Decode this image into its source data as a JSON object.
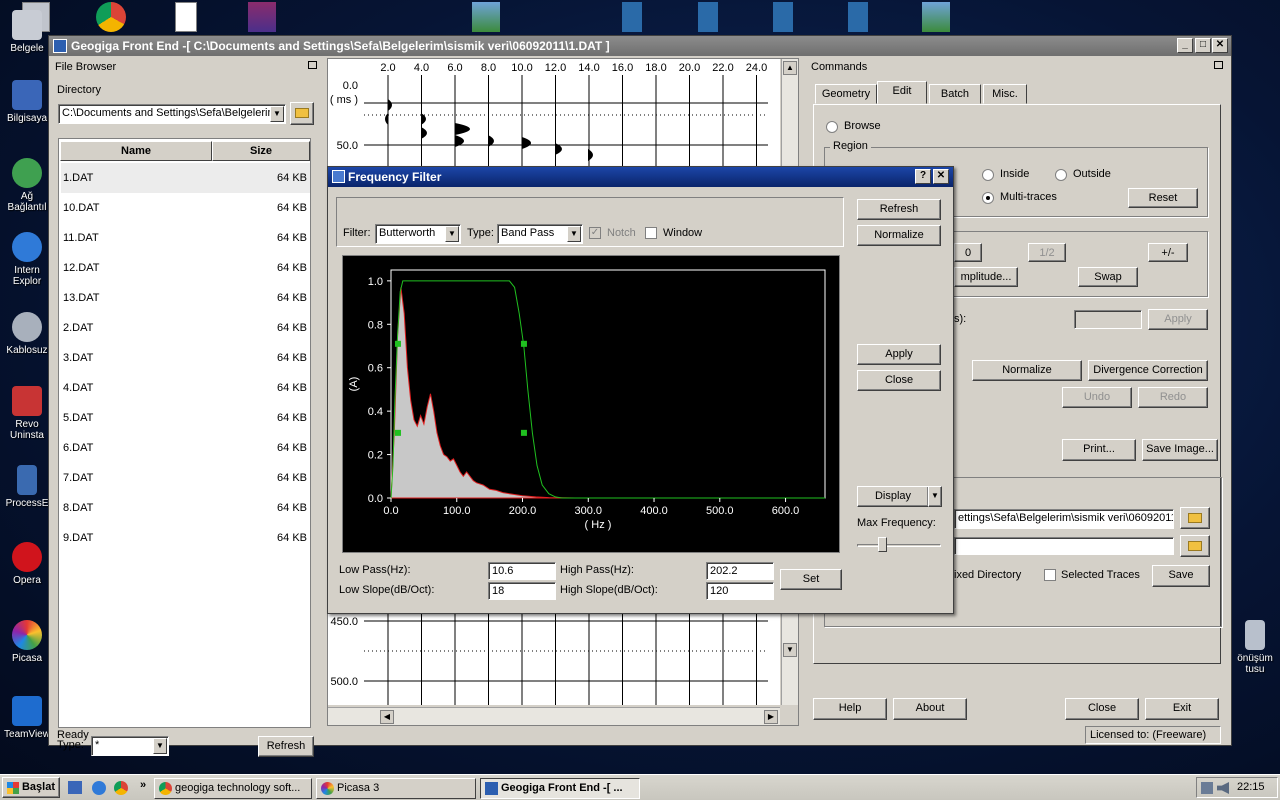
{
  "desktop": {
    "icons": [
      "Belgele",
      "Bilgisaya",
      "Ağ Bağlantıl",
      "Intern Explor",
      "Kablosuz",
      "Revo Uninsta",
      "ProcessE",
      "Opera",
      "Picasa",
      "TeamView"
    ],
    "right_icon": "önüşüm tusu"
  },
  "window": {
    "title": "Geogiga Front End -[ C:\\Documents and Settings\\Sefa\\Belgelerim\\sismik veri\\06092011\\1.DAT  ]",
    "status": "Ready",
    "license": "Licensed to: (Freeware)"
  },
  "file_browser": {
    "title": "File Browser",
    "directory_label": "Directory",
    "directory_value": "C:\\Documents and Settings\\Sefa\\Belgelerim",
    "col_name": "Name",
    "col_size": "Size",
    "files": [
      {
        "name": "1.DAT",
        "size": "64 KB"
      },
      {
        "name": "10.DAT",
        "size": "64 KB"
      },
      {
        "name": "11.DAT",
        "size": "64 KB"
      },
      {
        "name": "12.DAT",
        "size": "64 KB"
      },
      {
        "name": "13.DAT",
        "size": "64 KB"
      },
      {
        "name": "2.DAT",
        "size": "64 KB"
      },
      {
        "name": "3.DAT",
        "size": "64 KB"
      },
      {
        "name": "4.DAT",
        "size": "64 KB"
      },
      {
        "name": "5.DAT",
        "size": "64 KB"
      },
      {
        "name": "6.DAT",
        "size": "64 KB"
      },
      {
        "name": "7.DAT",
        "size": "64 KB"
      },
      {
        "name": "8.DAT",
        "size": "64 KB"
      },
      {
        "name": "9.DAT",
        "size": "64 KB"
      }
    ],
    "type_label": "Type:",
    "type_value": "*",
    "refresh": "Refresh"
  },
  "seismic": {
    "x_ticks": [
      "2.0",
      "4.0",
      "6.0",
      "8.0",
      "10.0",
      "12.0",
      "14.0",
      "16.0",
      "18.0",
      "20.0",
      "22.0",
      "24.0"
    ],
    "y_top": [
      "0.0",
      "( ms )",
      "50.0"
    ],
    "y_bottom": [
      "450.0",
      "500.0"
    ]
  },
  "commands": {
    "title": "Commands",
    "tabs": [
      "Geometry",
      "Edit",
      "Batch",
      "Misc."
    ],
    "browse": "Browse",
    "region": "Region",
    "inside": "Inside",
    "outside": "Outside",
    "multi_traces": "Multi-traces",
    "reset": "Reset",
    "zero": "0",
    "half": "1/2",
    "plus_minus": "+/-",
    "amplitude": "mplitude...",
    "swap": "Swap",
    "s_label": "s):",
    "apply": "Apply",
    "normalize": "Normalize",
    "divergence": "Divergence Correction",
    "undo": "Undo",
    "redo": "Redo",
    "print": "Print...",
    "save_image": "Save Image...",
    "path1": "ettings\\Sefa\\Belgelerim\\sismik veri\\06092011",
    "fixed_dir": "ixed Directory",
    "selected_traces": "Selected Traces",
    "save": "Save",
    "help": "Help",
    "about": "About",
    "close": "Close",
    "exit": "Exit"
  },
  "dialog": {
    "title": "Frequency Filter",
    "filter_label": "Filter:",
    "filter_value": "Butterworth",
    "type_label": "Type:",
    "type_value": "Band Pass",
    "notch": "Notch",
    "window": "Window",
    "refresh": "Refresh",
    "normalize": "Normalize",
    "apply": "Apply",
    "close": "Close",
    "display": "Display",
    "max_freq": "Max Frequency:",
    "max_freq_slider": 0.28,
    "low_pass_label": "Low Pass(Hz):",
    "low_pass_value": "10.6",
    "high_pass_label": "High Pass(Hz):",
    "high_pass_value": "202.2",
    "low_slope_label": "Low Slope(dB/Oct):",
    "low_slope_value": "18",
    "high_slope_label": "High Slope(dB/Oct):",
    "high_slope_value": "120",
    "set": "Set"
  },
  "chart_data": {
    "type": "area",
    "xlabel": "( Hz )",
    "ylabel": "(A)",
    "xlim": [
      0,
      660
    ],
    "ylim": [
      0,
      1.05
    ],
    "x_ticks": [
      0,
      100,
      200,
      300,
      400,
      500,
      600
    ],
    "x_tick_labels": [
      "0.0",
      "100.0",
      "200.0",
      "300.0",
      "400.0",
      "500.0",
      "600.0"
    ],
    "y_ticks": [
      0,
      0.2,
      0.4,
      0.6,
      0.8,
      1.0
    ],
    "y_tick_labels": [
      "0.0",
      "0.2",
      "0.4",
      "0.6",
      "0.8",
      "1.0"
    ],
    "spectrum": {
      "x": [
        0,
        5,
        10,
        15,
        20,
        25,
        30,
        35,
        40,
        45,
        50,
        55,
        60,
        65,
        70,
        75,
        80,
        85,
        90,
        95,
        100,
        105,
        110,
        115,
        120,
        125,
        130,
        140,
        150,
        160,
        170,
        180,
        190,
        200,
        220,
        240,
        260,
        280
      ],
      "y": [
        0,
        0.3,
        0.75,
        0.97,
        0.85,
        0.6,
        0.45,
        0.36,
        0.33,
        0.38,
        0.34,
        0.42,
        0.48,
        0.4,
        0.3,
        0.24,
        0.2,
        0.19,
        0.17,
        0.18,
        0.15,
        0.12,
        0.1,
        0.12,
        0.1,
        0.08,
        0.07,
        0.06,
        0.04,
        0.035,
        0.025,
        0.02,
        0.015,
        0.01,
        0.005,
        0.002,
        0.001,
        0
      ]
    },
    "filter_curve": {
      "x": [
        0,
        3,
        6,
        10,
        14,
        18,
        22,
        180,
        188,
        195,
        202,
        208,
        215,
        222,
        230,
        240,
        250,
        260,
        660
      ],
      "y": [
        0,
        0.15,
        0.45,
        0.75,
        0.95,
        1.0,
        1.0,
        1.0,
        0.97,
        0.85,
        0.7,
        0.5,
        0.3,
        0.15,
        0.06,
        0.02,
        0.005,
        0,
        0
      ]
    },
    "handles": {
      "x": [
        10.6,
        10.6,
        202.2,
        202.2
      ],
      "y": [
        0.71,
        0.3,
        0.71,
        0.3
      ]
    }
  },
  "taskbar": {
    "start": "Başlat",
    "tasks": [
      "geogiga technology soft...",
      "Picasa 3",
      "Geogiga Front End -[ ..."
    ],
    "clock": "22:15"
  }
}
